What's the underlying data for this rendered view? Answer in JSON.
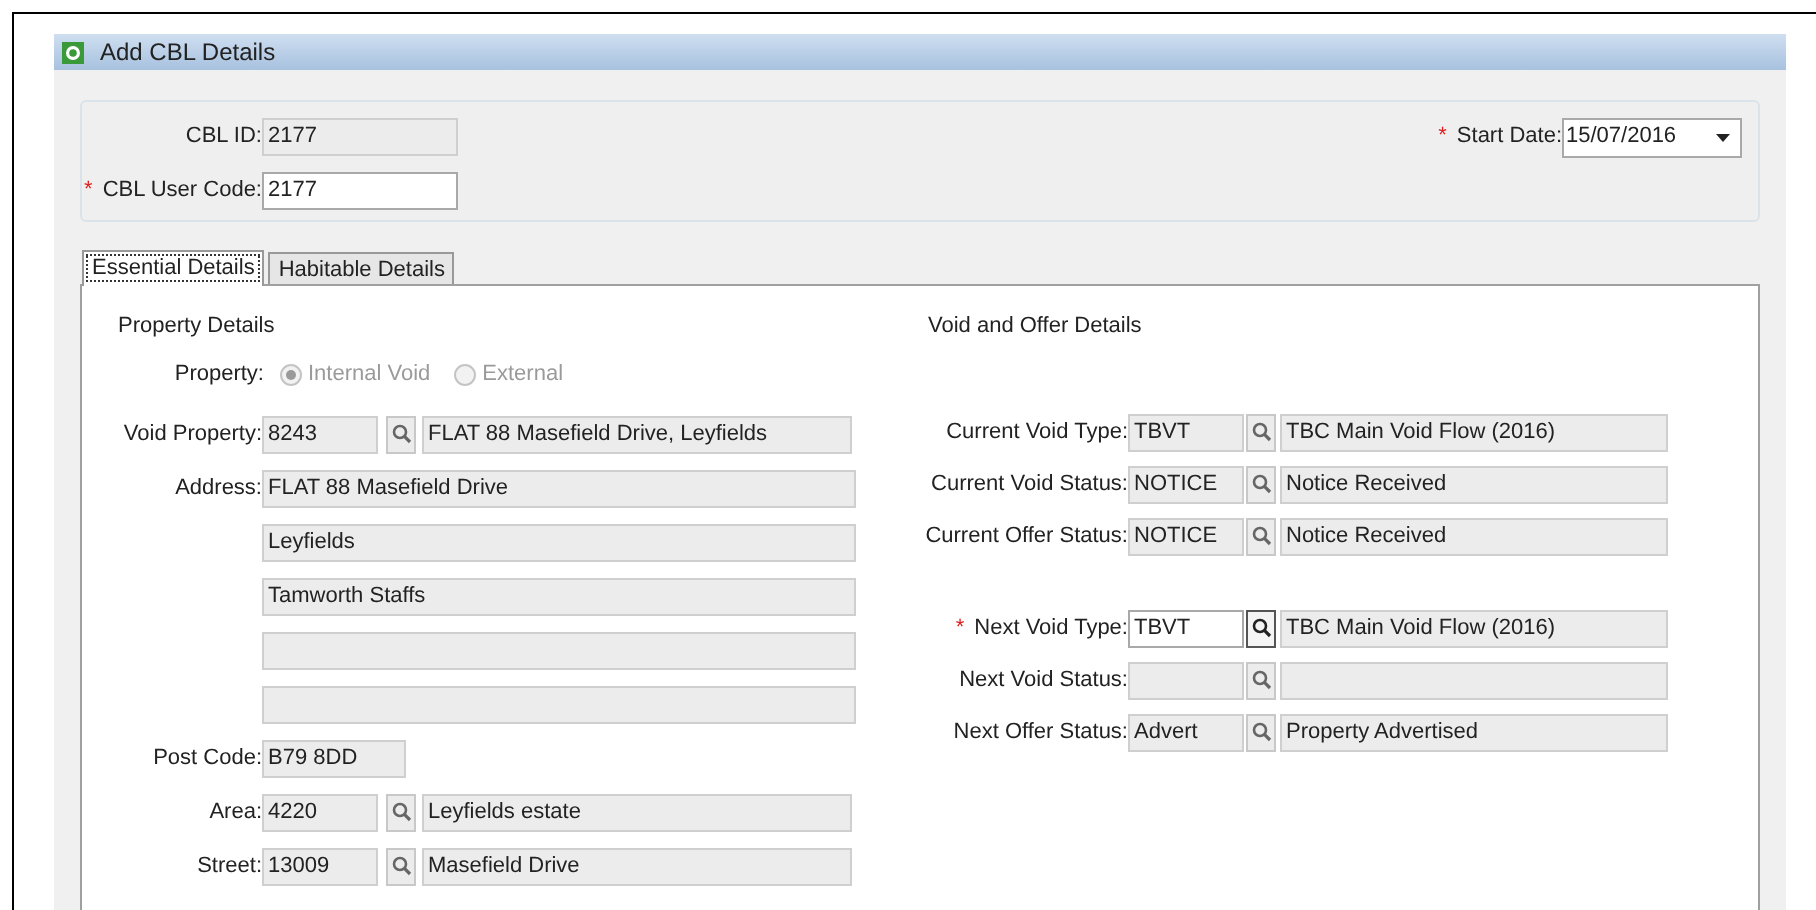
{
  "window": {
    "title": "Add CBL Details"
  },
  "header": {
    "fields": [
      {
        "label": "CBL ID:",
        "value": "2177",
        "editable": false
      },
      {
        "required_mark": "*",
        "label": "CBL User Code:",
        "value": "2177",
        "editable": true
      }
    ],
    "start_date": {
      "required_mark": "*",
      "label": "Start Date:",
      "value": "15/07/2016"
    }
  },
  "tabs": [
    {
      "label": "Essential Details",
      "selected": true
    },
    {
      "label": "Habitable Details",
      "selected": false
    }
  ],
  "property_details": {
    "title": "Property Details",
    "property": {
      "label": "Property:",
      "disabled": true,
      "options": [
        {
          "label": "Internal Void",
          "selected": true
        },
        {
          "label": "External",
          "selected": false
        }
      ]
    },
    "fields": [
      {
        "kind": "lookup",
        "label": "Void Property:",
        "code": "8243",
        "description": "FLAT 88 Masefield Drive, Leyfields"
      },
      {
        "kind": "text",
        "label": "Address:",
        "value": "FLAT 88 Masefield Drive"
      },
      {
        "kind": "text",
        "value": "Leyfields"
      },
      {
        "kind": "text",
        "value": "Tamworth Staffs"
      },
      {
        "kind": "text"
      },
      {
        "kind": "text"
      },
      {
        "kind": "short",
        "label": "Post Code:",
        "value": "B79 8DD"
      },
      {
        "kind": "lookup",
        "label": "Area:",
        "code": "4220",
        "description": "Leyfields estate"
      },
      {
        "kind": "lookup",
        "label": "Street:",
        "code": "13009",
        "description": "Masefield Drive"
      }
    ]
  },
  "void_and_offer_details": {
    "title": "Void and Offer Details",
    "groups": [
      [
        {
          "label": "Current Void Type:",
          "code": "TBVT",
          "description": "TBC Main Void Flow (2016)",
          "editable": false
        },
        {
          "label": "Current Void Status:",
          "code": "NOTICE",
          "description": "Notice Received",
          "editable": false
        },
        {
          "label": "Current Offer Status:",
          "code": "NOTICE",
          "description": "Notice Received",
          "editable": false
        }
      ],
      [
        {
          "required_mark": "*",
          "label": "Next Void Type:",
          "code": "TBVT",
          "description": "TBC Main Void Flow (2016)",
          "editable": true
        },
        {
          "label": "Next Void Status:",
          "editable": false
        },
        {
          "label": "Next Offer Status:",
          "code": "Advert",
          "description": "Property Advertised",
          "editable": false
        }
      ]
    ]
  }
}
